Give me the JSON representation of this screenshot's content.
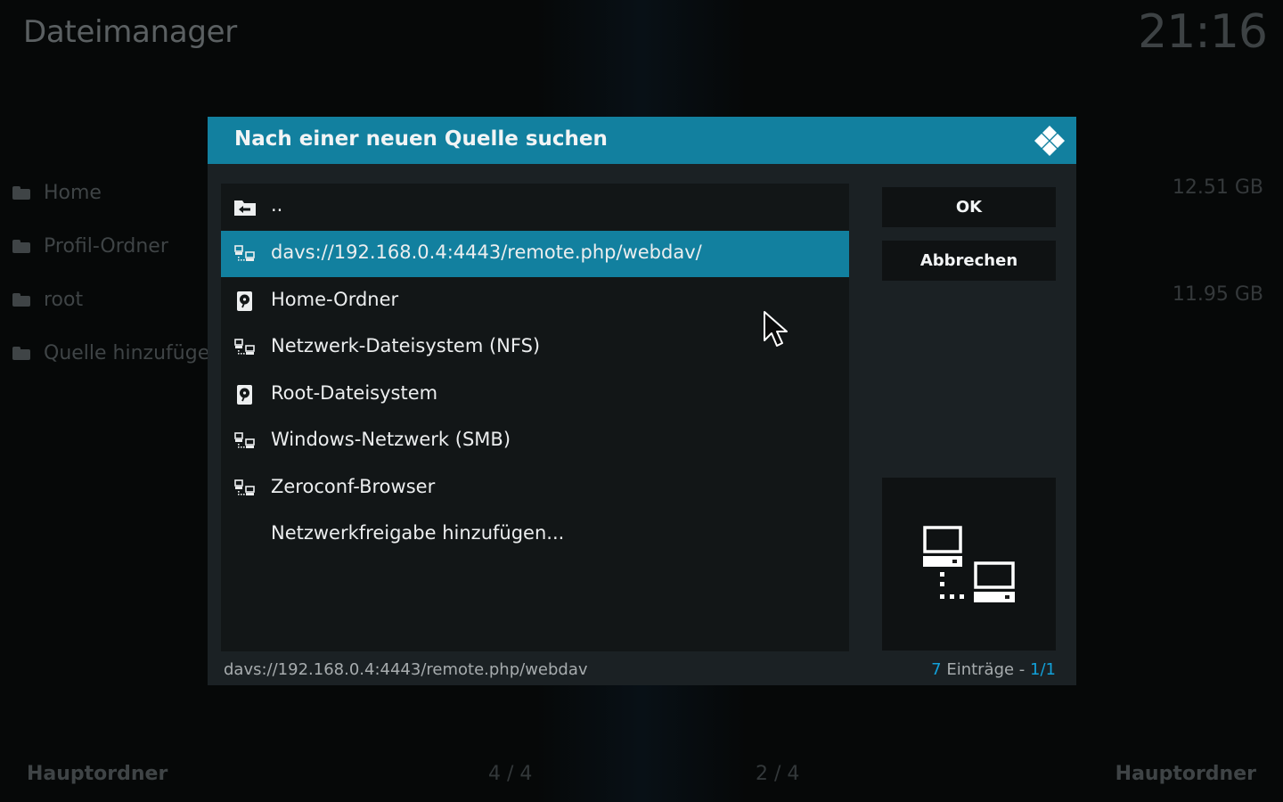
{
  "background": {
    "title": "Dateimanager",
    "clock": "21:16",
    "sources": [
      {
        "label": "Home",
        "size": "12.51 GB"
      },
      {
        "label": "Profil-Ordner",
        "size": ""
      },
      {
        "label": "root",
        "size": "11.95 GB"
      },
      {
        "label": "Quelle hinzufüge",
        "size": ""
      }
    ],
    "footer": {
      "left_label": "Hauptordner",
      "left_count": "4 / 4",
      "right_count": "2 / 4",
      "right_label": "Hauptordner"
    }
  },
  "dialog": {
    "title": "Nach einer neuen Quelle suchen",
    "logo_icon": "kodi-logo-icon",
    "accent_color": "#12809f",
    "items": [
      {
        "label": "..",
        "icon": "parent-folder-icon"
      },
      {
        "label": "davs://192.168.0.4:4443/remote.php/webdav/",
        "icon": "network-icon",
        "focused": true
      },
      {
        "label": "Home-Ordner",
        "icon": "harddisk-icon"
      },
      {
        "label": "Netzwerk-Dateisystem (NFS)",
        "icon": "network-icon"
      },
      {
        "label": "Root-Dateisystem",
        "icon": "harddisk-icon"
      },
      {
        "label": "Windows-Netzwerk (SMB)",
        "icon": "network-icon"
      },
      {
        "label": "Zeroconf-Browser",
        "icon": "network-icon"
      },
      {
        "label": "Netzwerkfreigabe hinzufügen...",
        "icon": ""
      }
    ],
    "buttons": {
      "ok": "OK",
      "cancel": "Abbrechen"
    },
    "preview_icon": "network-computers-icon",
    "status": {
      "path": "davs://192.168.0.4:4443/remote.php/webdav",
      "count": "7",
      "count_text": " Einträge - ",
      "page": "1/1"
    }
  }
}
